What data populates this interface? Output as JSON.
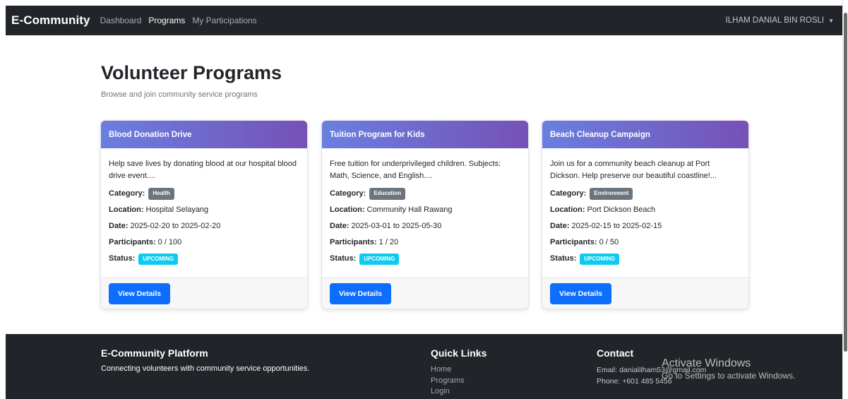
{
  "navbar": {
    "brand": "E-Community",
    "links": [
      "Dashboard",
      "Programs",
      "My Participations"
    ],
    "user": "ILHAM DANIAL BIN ROSLI"
  },
  "page": {
    "title": "Volunteer Programs",
    "subtitle": "Browse and join community service programs"
  },
  "labels": {
    "category": "Category:",
    "location": "Location:",
    "date": "Date:",
    "participants": "Participants:",
    "status": "Status:",
    "view_details": "View Details"
  },
  "programs": [
    {
      "title": "Blood Donation Drive",
      "description": "Help save lives by donating blood at our hospital blood drive event....",
      "category": "Health",
      "location": "Hospital Selayang",
      "date": "2025-02-20 to 2025-02-20",
      "participants": "0 / 100",
      "status": "UPCOMING"
    },
    {
      "title": "Tuition Program for Kids",
      "description": "Free tuition for underprivileged children. Subjects: Math, Science, and English....",
      "category": "Education",
      "location": "Community Hall Rawang",
      "date": "2025-03-01 to 2025-05-30",
      "participants": "1 / 20",
      "status": "UPCOMING"
    },
    {
      "title": "Beach Cleanup Campaign",
      "description": "Join us for a community beach cleanup at Port Dickson. Help preserve our beautiful coastline!...",
      "category": "Environment",
      "location": "Port Dickson Beach",
      "date": "2025-02-15 to 2025-02-15",
      "participants": "0 / 50",
      "status": "UPCOMING"
    }
  ],
  "footer": {
    "platform_title": "E-Community Platform",
    "platform_text": "Connecting volunteers with community service opportunities.",
    "quick_links_title": "Quick Links",
    "quick_links": [
      "Home",
      "Programs",
      "Login"
    ],
    "contact_title": "Contact",
    "email": "Email: danialilham53@gmail.com",
    "phone": "Phone: +601 485 5456"
  },
  "overlay": {
    "activate_title": "Activate Windows",
    "activate_sub": "Go to Settings to activate Windows."
  },
  "colors": {
    "navbar_bg": "#212529",
    "header_gradient_start": "#6a7fe0",
    "header_gradient_end": "#7651b6",
    "primary_button": "#0d6efd",
    "badge_category": "#6c757d",
    "badge_status": "#0dcaf0"
  }
}
